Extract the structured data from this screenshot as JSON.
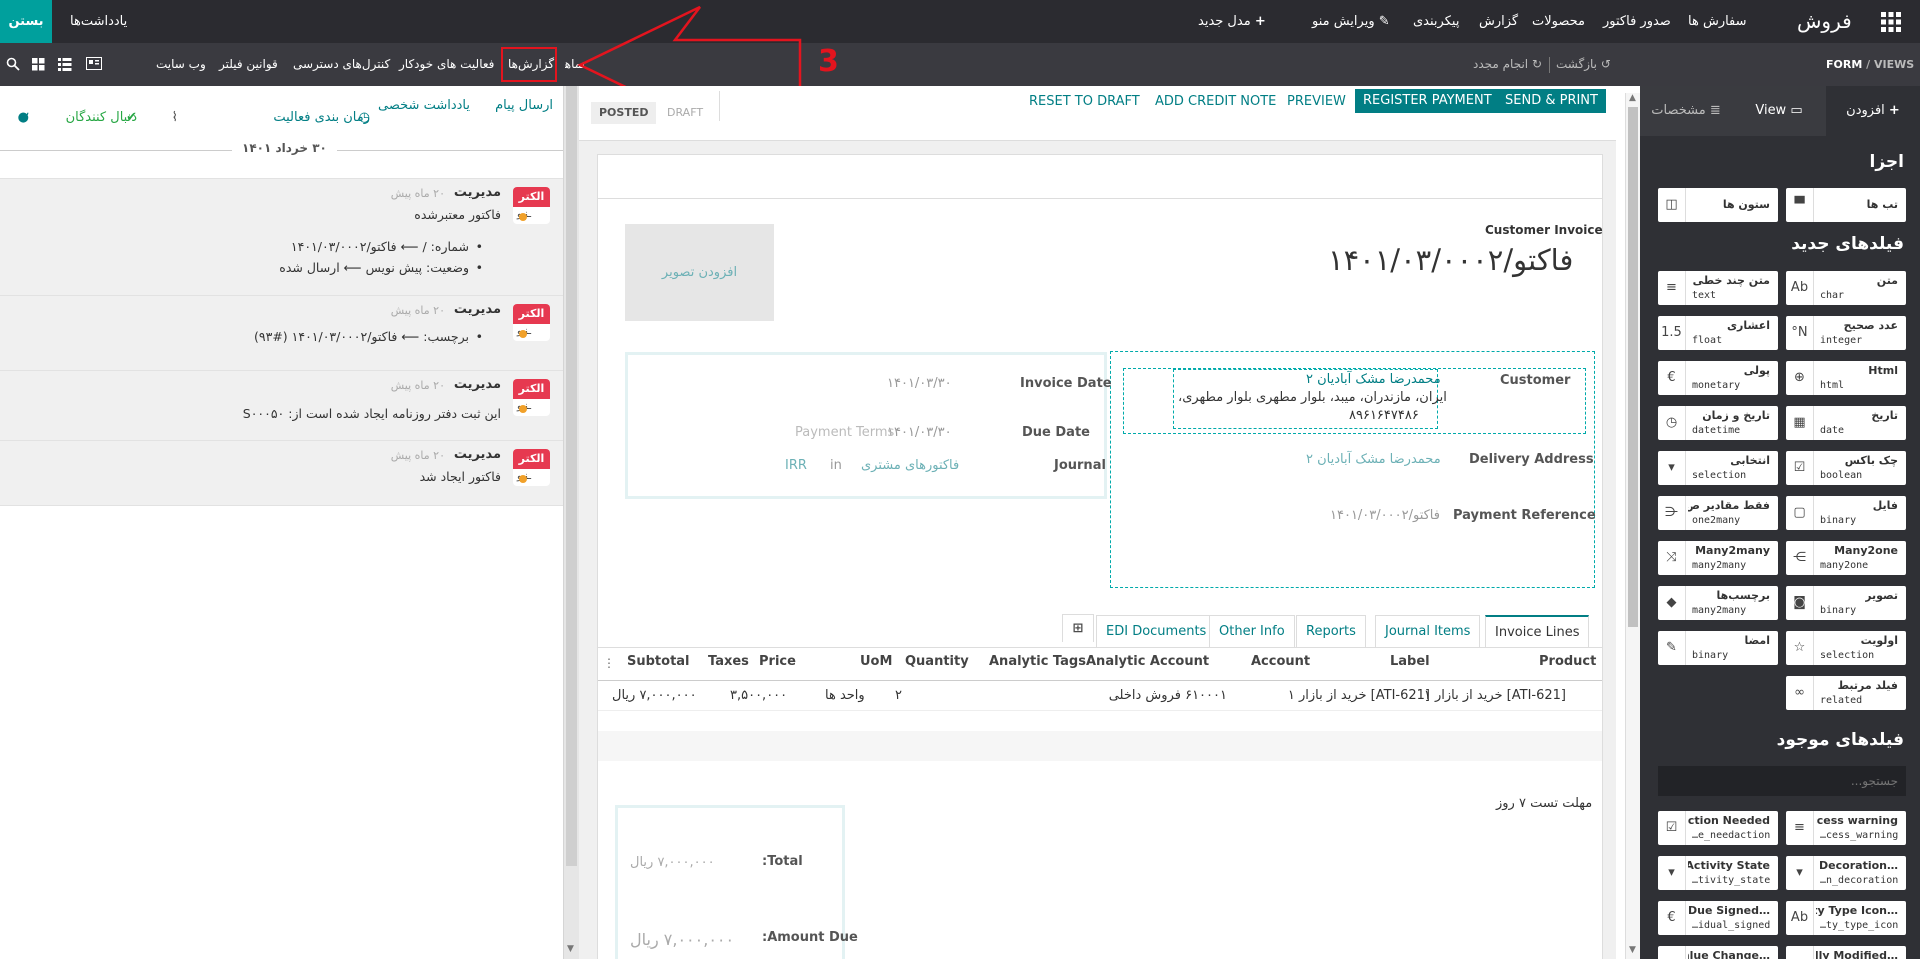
{
  "topbar": {
    "app_name": "فروش",
    "menu": [
      "سفارش ها",
      "صدور فاکتور",
      "محصولات",
      "گزارش",
      "پیکربندی"
    ],
    "edit_menu": "ویرایش منو",
    "new_model": "مدل جدید",
    "notes": "یادداشت‌ها",
    "close": "بستن"
  },
  "subbar": {
    "breadcrumb_views": "VIEWS",
    "breadcrumb_form": "FORM",
    "back": "بازگشت",
    "redo": "انجام مجدد",
    "tabs": [
      "وب سایت",
      "قوانین فیلتر",
      "کنترل‌های دسترسی",
      "فعالیت های خودکار",
      "گزارش‌ها",
      "نماها"
    ],
    "annotation_number": "3"
  },
  "chatter": {
    "actions": {
      "send_message": "ارسال پیام",
      "log_note": "یادداشت شخصی",
      "schedule": "زمان بندی فعالیت",
      "attachments": "۰",
      "follow": "دنبال کنندگان",
      "followers": "۲"
    },
    "date_sep": "۳۰ خرداد ۱۴۰۱",
    "messages": [
      {
        "author": "مدیریت",
        "time": "۲۰ ماه پیش",
        "body": "فاکتور معتبرشده",
        "items": [
          "شماره: / ⟵ فاکتو/۱۴۰۱/۰۳/۰۰۰۲",
          "وضعیت: پیش نویس ⟵ ارسال شده"
        ]
      },
      {
        "author": "مدیریت",
        "time": "۲۰ ماه پیش",
        "body": "",
        "items": [
          "برچسب: ⟵ فاکتو/۱۴۰۱/۰۳/۰۰۰۲ (#۹۳)"
        ]
      },
      {
        "author": "مدیریت",
        "time": "۲۰ ماه پیش",
        "body": "این ثبت دفتر روزنامه ایجاد شده است از: S۰۰۰۵۰",
        "items": []
      },
      {
        "author": "مدیریت",
        "time": "۲۰ ماه پیش",
        "body": "فاکتور ایجاد شد",
        "items": []
      }
    ],
    "avatar_text": "الکتر",
    "avatar_sub": "ـنـو"
  },
  "form": {
    "status": [
      "POSTED",
      "DRAFT"
    ],
    "buttons": {
      "reset": "RESET TO DRAFT",
      "credit": "ADD CREDIT NOTE",
      "preview": "PREVIEW",
      "register": "REGISTER PAYMENT",
      "send": "SEND & PRINT"
    },
    "doc_type": "Customer Invoice",
    "number": "فاکتو/۱۴۰۱/۰۳/۰۰۰۲",
    "add_image": "افزودن تصویر",
    "customer_label": "Customer",
    "customer_name": "محمدرضا مشک آبادیان ۲",
    "customer_addr1": "ایران، مازندران، میبد، بلوار مطهری بلوار مطهری،",
    "customer_addr2": "۸۹۶۱۶۴۷۴۸۶",
    "delivery_label": "Delivery Address",
    "delivery_value": "محمدرضا مشک آبادیان ۲",
    "payref_label": "Payment Reference",
    "payref_value": "فاکتو/۱۴۰۱/۰۳/۰۰۰۲",
    "invdate_label": "Invoice Date",
    "invdate_value": "۱۴۰۱/۰۳/۳۰",
    "due_label": "Due Date",
    "due_value": "۱۴۰۱/۰۳/۳۰",
    "payment_terms": "Payment Terms",
    "journal_label": "Journal",
    "journal_value": "فاکتورهای مشتری",
    "journal_in": "in",
    "journal_currency": "IRR",
    "tabs": [
      "Invoice Lines",
      "Journal Items",
      "Reports",
      "Other Info",
      "EDI Documents"
    ],
    "columns": [
      "Product",
      "Label",
      "Account",
      "Analytic Account",
      "Analytic Tags",
      "Quantity",
      "UoM",
      "Price",
      "Taxes",
      "Subtotal"
    ],
    "line": {
      "product": "[ATI-621] خرید از بازار ۱",
      "label": "[ATI-621] خرید از بازار ۱",
      "account": "۶۱۰۰۰۱ فروش داخلی",
      "quantity": "۲",
      "uom": "واحد ها",
      "price": "۳,۵۰۰,۰۰۰",
      "subtotal": "۷,۰۰۰,۰۰۰ ریال"
    },
    "terms_note": "مهلت تست ۷ روز",
    "total_label": "Total:",
    "total_value": "۷,۰۰۰,۰۰۰ ریال",
    "due_total_label": "Amount Due:",
    "due_total_value": "۷,۰۰۰,۰۰۰ ریال"
  },
  "rpanel": {
    "tabs": [
      "افزودن",
      "View",
      "مشخصات"
    ],
    "components": "اجزا",
    "comp_items": [
      {
        "title": "تب ها"
      },
      {
        "title": "ستون ها"
      }
    ],
    "new_fields": "فیلدهای جدید",
    "new_items": [
      {
        "title": "متن",
        "type": "char",
        "icon": "Ab"
      },
      {
        "title": "متن چند خطی",
        "type": "text",
        "icon": "≡"
      },
      {
        "title": "عدد صحیح",
        "type": "integer",
        "icon": "N°"
      },
      {
        "title": "اعشاری",
        "type": "float",
        "icon": "1.5"
      },
      {
        "title": "Html",
        "type": "html",
        "icon": "⊕"
      },
      {
        "title": "پولی",
        "type": "monetary",
        "icon": "€"
      },
      {
        "title": "تاریخ",
        "type": "date",
        "icon": "▦"
      },
      {
        "title": "تاریخ و زمان",
        "type": "datetime",
        "icon": "◷"
      },
      {
        "title": "چک باکس",
        "type": "boolean",
        "icon": "☑"
      },
      {
        "title": "انتخابی",
        "type": "selection",
        "icon": "▾"
      },
      {
        "title": "فایل",
        "type": "binary",
        "icon": "▢"
      },
      {
        "title": "فقط مقادیر ص...",
        "type": "one2many",
        "icon": "⋲"
      },
      {
        "title": "Many2one",
        "type": "many2one",
        "icon": "⋺"
      },
      {
        "title": "Many2many",
        "type": "many2many",
        "icon": "⤨"
      },
      {
        "title": "تصویر",
        "type": "binary",
        "icon": "◙"
      },
      {
        "title": "برچسب‌ها",
        "type": "many2many",
        "icon": "◆"
      },
      {
        "title": "اولویت",
        "type": "selection",
        "icon": "☆"
      },
      {
        "title": "امضا",
        "type": "binary",
        "icon": "✎"
      },
      {
        "title": "فیلد مرتبط",
        "type": "related",
        "icon": "∞"
      }
    ],
    "existing_fields": "فیلدهای موجود",
    "search_placeholder": "جستجو...",
    "existing_items": [
      {
        "title": "Access warning",
        "type": "…cess_warning",
        "icon": "≡"
      },
      {
        "title": "Action Needed",
        "type": "…e_needaction",
        "icon": "☑"
      },
      {
        "title": "…n Decoration",
        "type": "…n_decoration",
        "icon": "▾"
      },
      {
        "title": "Activity State",
        "type": "…tivity_state",
        "icon": "▾"
      },
      {
        "title": "…ity Type Icon",
        "type": "…ty_type_icon",
        "icon": "Ab"
      },
      {
        "title": "…t Due Signed",
        "type": "…idual_signed",
        "icon": "€"
      },
      {
        "title": "…ally Modified",
        "type": "",
        "icon": ""
      },
      {
        "title": "…alue Change",
        "type": "",
        "icon": ""
      }
    ]
  }
}
